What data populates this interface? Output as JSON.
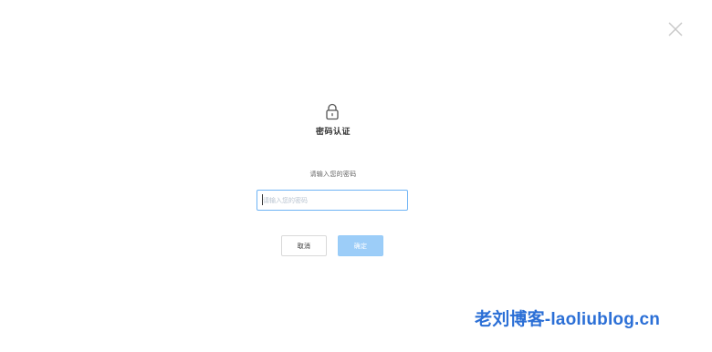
{
  "dialog": {
    "title": "密码认证",
    "prompt": "请输入您的密码",
    "password_placeholder": "请输入您的密码",
    "password_value": "",
    "cancel_label": "取消",
    "confirm_label": "确定",
    "icons": {
      "lock": "lock-icon",
      "close": "close-icon"
    }
  },
  "watermark": {
    "text": "老刘博客-laoliublog.cn"
  },
  "colors": {
    "input_border_focus": "#6fb4f5",
    "confirm_bg": "#9ccdf8",
    "confirm_text": "#ffffff",
    "watermark": "#2b6fd6",
    "close_icon": "#c8c8c8"
  }
}
